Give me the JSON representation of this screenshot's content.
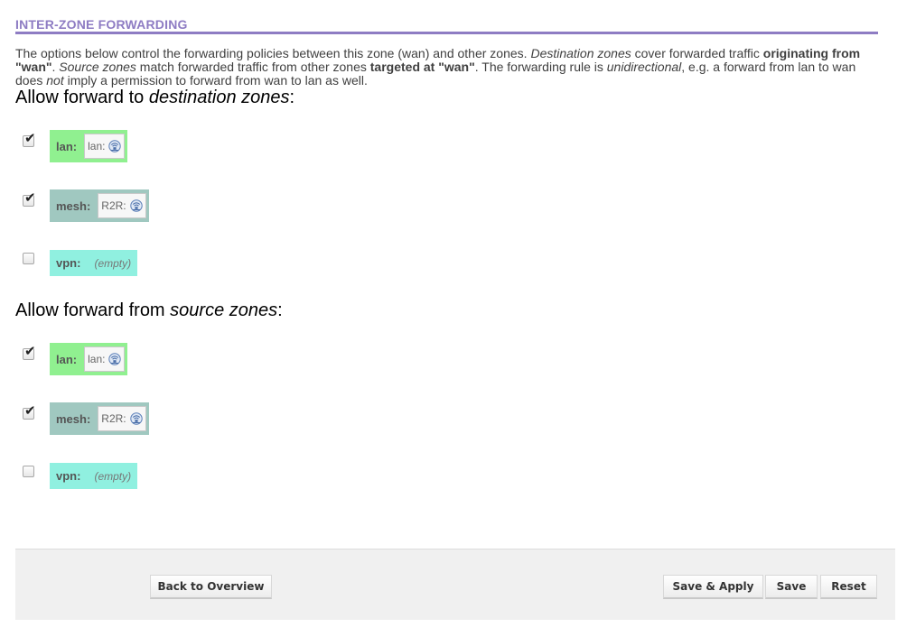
{
  "section": {
    "title": "INTER-ZONE FORWARDING",
    "desc": {
      "p1": "The options below control the forwarding policies between this zone (wan) and other zones. ",
      "p2_italic": "Destination zones",
      "p3": " cover forwarded traffic ",
      "p4_bold": "originating from \"wan\"",
      "p5": ". ",
      "p6_italic": "Source zones",
      "p7": " match forwarded traffic from other zones ",
      "p8_bold": "targeted at \"wan\"",
      "p9": ". The forwarding rule is ",
      "p10_italic": "unidirectional",
      "p11": ", e.g. a forward from lan to wan does ",
      "p12_italic": "not",
      "p13": " imply a permission to forward from wan to lan as well."
    }
  },
  "dest": {
    "heading_prefix": "Allow forward to ",
    "heading_italic": "destination zones",
    "heading_suffix": ":",
    "zones": [
      {
        "name": "lan:",
        "network": "lan:",
        "checked": true,
        "color": "#90f090",
        "icon": "ethernet-icon"
      },
      {
        "name": "mesh:",
        "network": "R2R:",
        "checked": true,
        "color": "#a0c8c0",
        "icon": "ethernet-icon"
      },
      {
        "name": "vpn:",
        "empty": "(empty)",
        "checked": false,
        "color": "#90f0e0"
      }
    ]
  },
  "src": {
    "heading_prefix": "Allow forward from ",
    "heading_italic": "source zones",
    "heading_suffix": ":",
    "zones": [
      {
        "name": "lan:",
        "network": "lan:",
        "checked": true,
        "color": "#90f090",
        "icon": "ethernet-icon"
      },
      {
        "name": "mesh:",
        "network": "R2R:",
        "checked": true,
        "color": "#a0c8c0",
        "icon": "ethernet-icon"
      },
      {
        "name": "vpn:",
        "empty": "(empty)",
        "checked": false,
        "color": "#90f0e0"
      }
    ]
  },
  "footer": {
    "back": "Back to Overview",
    "save_apply": "Save & Apply",
    "save": "Save",
    "reset": "Reset"
  },
  "colors": {
    "accent": "#8e7cc3",
    "footer_bg": "#f0f0f0"
  },
  "check_glyph": "✔"
}
